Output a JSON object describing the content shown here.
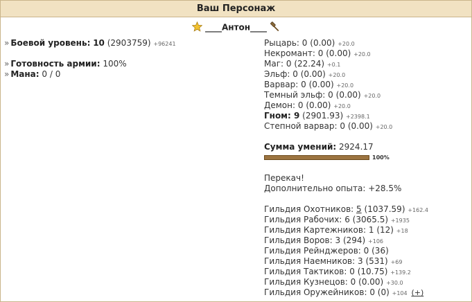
{
  "header": {
    "title": "Ваш Персонаж"
  },
  "character": {
    "name": "____Антон____"
  },
  "left": {
    "combat_label": "Боевой уровень:",
    "combat_value": "10",
    "combat_exp": "(2903759)",
    "combat_delta": "+96241",
    "readiness_label": "Готовность армии:",
    "readiness_value": "100%",
    "mana_label": "Мана:",
    "mana_value": "0 / 0"
  },
  "factions": [
    {
      "name": "Рыцарь:",
      "level": "0",
      "pts": "(0.00)",
      "delta": "+20.0"
    },
    {
      "name": "Некромант:",
      "level": "0",
      "pts": "(0.00)",
      "delta": "+20.0"
    },
    {
      "name": "Маг:",
      "level": "0",
      "pts": "(22.24)",
      "delta": "+0.1"
    },
    {
      "name": "Эльф:",
      "level": "0",
      "pts": "(0.00)",
      "delta": "+20.0"
    },
    {
      "name": "Варвар:",
      "level": "0",
      "pts": "(0.00)",
      "delta": "+20.0"
    },
    {
      "name": "Темный эльф:",
      "level": "0",
      "pts": "(0.00)",
      "delta": "+20.0"
    },
    {
      "name": "Демон:",
      "level": "0",
      "pts": "(0.00)",
      "delta": "+20.0"
    },
    {
      "name": "Гном: 9",
      "level": "",
      "pts": "(2901.93)",
      "delta": "+2398.1",
      "bold": true
    },
    {
      "name": "Степной варвар:",
      "level": "0",
      "pts": "(0.00)",
      "delta": "+20.0"
    }
  ],
  "skills": {
    "label": "Сумма умений:",
    "value": "2924.17",
    "progress": 1.0,
    "progress_label": "100%"
  },
  "overexp": {
    "line1": "Перекач!",
    "line2": "Дополнительно опыта: +28.5%"
  },
  "guilds": [
    {
      "name": "Гильдия Охотников:",
      "level": "5",
      "pts": "(1037.59)",
      "delta": "+162.4",
      "underline": true
    },
    {
      "name": "Гильдия Рабочих:",
      "level": "6",
      "pts": "(3065.5)",
      "delta": "+1935"
    },
    {
      "name": "Гильдия Картежников:",
      "level": "1",
      "pts": "(12)",
      "delta": "+18"
    },
    {
      "name": "Гильдия Воров:",
      "level": "3",
      "pts": "(294)",
      "delta": "+106"
    },
    {
      "name": "Гильдия Рейнджеров:",
      "level": "0",
      "pts": "(36)",
      "delta": ""
    },
    {
      "name": "Гильдия Наемников:",
      "level": "3",
      "pts": "(531)",
      "delta": "+69"
    },
    {
      "name": "Гильдия Тактиков:",
      "level": "0",
      "pts": "(10.75)",
      "delta": "+139.2"
    },
    {
      "name": "Гильдия Кузнецов:",
      "level": "0",
      "pts": "(0.00)",
      "delta": "+30.0"
    },
    {
      "name": "Гильдия Оружейников:",
      "level": "0",
      "pts": "(0)",
      "delta": "+104",
      "plus": "(+)"
    }
  ],
  "colors": {
    "header_bg": "#f1e2c2",
    "border": "#c9b48a",
    "bar_fill": "#9c7440"
  },
  "icons": {
    "rank": "star-icon",
    "profession": "hammer-icon"
  }
}
